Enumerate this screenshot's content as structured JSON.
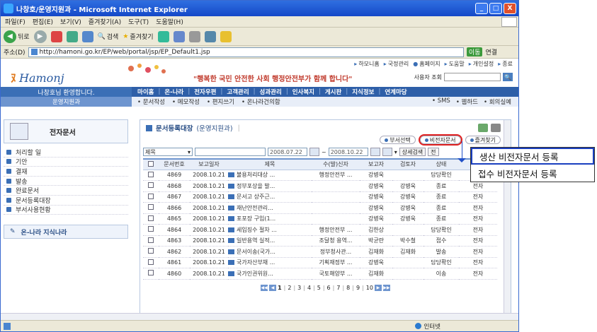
{
  "window": {
    "title": "나창호/운영지원과 - Microsoft Internet Explorer",
    "minimize": "_",
    "maximize": "□",
    "close": "X"
  },
  "menu": [
    "파일(F)",
    "편집(E)",
    "보기(V)",
    "즐겨찾기(A)",
    "도구(T)",
    "도움말(H)"
  ],
  "toolbar": {
    "back": "뒤로",
    "search": "검색",
    "favorites": "즐겨찾기"
  },
  "address": {
    "label": "주소(D)",
    "url": "http://hamoni.go.kr/EP/web/portal/jsp/EP_Default1.jsp",
    "go": "이동",
    "links": "연결"
  },
  "header": {
    "logo": "Hamonj",
    "slogan": "\"행복한 국민 안전한 사회 행정안전부가 함께 합니다\"",
    "top_links": [
      "하모니홈",
      "국정관리",
      "홈페이지",
      "도움말",
      "개인설정",
      "종료"
    ],
    "search_label": "사용자 조회"
  },
  "nav": {
    "welcome": "나창호님 환영합니다.",
    "dept": "운영지원과",
    "main": [
      "마이홈",
      "온-나라",
      "전자우편",
      "고객관리",
      "성과관리",
      "인사복지",
      "게시판",
      "지식정보",
      "연계마당"
    ],
    "sub": [
      "문서작성",
      "메모작성",
      "편지쓰기",
      "온나라건의함"
    ],
    "sub_right": [
      "SMS",
      "웹하드",
      "회의실예"
    ]
  },
  "sidebar": {
    "title": "전자문서",
    "items": [
      "처리할 일",
      "기안",
      "결재",
      "발송",
      "완료문서",
      "문서등록대장",
      "부서사용현황"
    ],
    "onnara": "온-나라 지식나라"
  },
  "content": {
    "title": "문서등록대장",
    "dept": "(운영지원과)",
    "buttons": {
      "dept_select": "부서선택",
      "non_electronic": "비전자문서",
      "favorites": "즐겨찾기"
    },
    "filter": {
      "field": "제목",
      "date_from": "2008.07.22",
      "date_to": "2008.10.22",
      "detail_search": "상세검색",
      "all": "전"
    },
    "columns": [
      "문서번호",
      "보고일자",
      "제목",
      "수(발)신자",
      "보고자",
      "검토자",
      "상태",
      "비고"
    ],
    "rows": [
      {
        "no": "4869",
        "date": "2008.10.21",
        "title": "불용처리대상 ...",
        "recv": "행정안전부 ...",
        "reporter": "강병욱",
        "reviewer": "",
        "status": "담당확인",
        "type": "전자"
      },
      {
        "no": "4868",
        "date": "2008.10.21",
        "title": "정부포상을 발...",
        "recv": "",
        "reporter": "강병욱",
        "reviewer": "강병욱",
        "status": "종료",
        "type": "전자"
      },
      {
        "no": "4867",
        "date": "2008.10.21",
        "title": "문서고 상주근...",
        "recv": "",
        "reporter": "강병욱",
        "reviewer": "강병욱",
        "status": "종료",
        "type": "전자"
      },
      {
        "no": "4866",
        "date": "2008.10.21",
        "title": "재난안전관리...",
        "recv": "",
        "reporter": "강병욱",
        "reviewer": "강병욱",
        "status": "종료",
        "type": "전자"
      },
      {
        "no": "4865",
        "date": "2008.10.21",
        "title": "포포장 구입(1...",
        "recv": "",
        "reporter": "강병욱",
        "reviewer": "강병욱",
        "status": "종료",
        "type": "전자"
      },
      {
        "no": "4864",
        "date": "2008.10.21",
        "title": "세입징수 절차 ...",
        "recv": "행정안전부 ...",
        "reporter": "김한상",
        "reviewer": "",
        "status": "담당확인",
        "type": "전자"
      },
      {
        "no": "4863",
        "date": "2008.10.21",
        "title": "일반용역 실적...",
        "recv": "조달청 용역...",
        "reporter": "박균란",
        "reviewer": "박수철",
        "status": "접수",
        "type": "전자"
      },
      {
        "no": "4862",
        "date": "2008.10.21",
        "title": "문서이송(국가...",
        "recv": "정부청사관...",
        "reporter": "김재화",
        "reviewer": "김재화",
        "status": "발송",
        "type": "전자"
      },
      {
        "no": "4861",
        "date": "2008.10.21",
        "title": "국가자산부채 ...",
        "recv": "기획재정부 ...",
        "reporter": "강병욱",
        "reviewer": "",
        "status": "담당확인",
        "type": "전자"
      },
      {
        "no": "4860",
        "date": "2008.10.21",
        "title": "국가인권위원...",
        "recv": "국토해양부 ...",
        "reporter": "김재화",
        "reviewer": "",
        "status": "이송",
        "type": "전자"
      }
    ],
    "pages": [
      "1",
      "2",
      "3",
      "4",
      "5",
      "6",
      "7",
      "8",
      "9",
      "10"
    ]
  },
  "status": {
    "zone": "인터넷"
  },
  "dropdown": {
    "items": [
      "생산 비전자문서 등록",
      "접수 비전자문서 등록"
    ]
  }
}
